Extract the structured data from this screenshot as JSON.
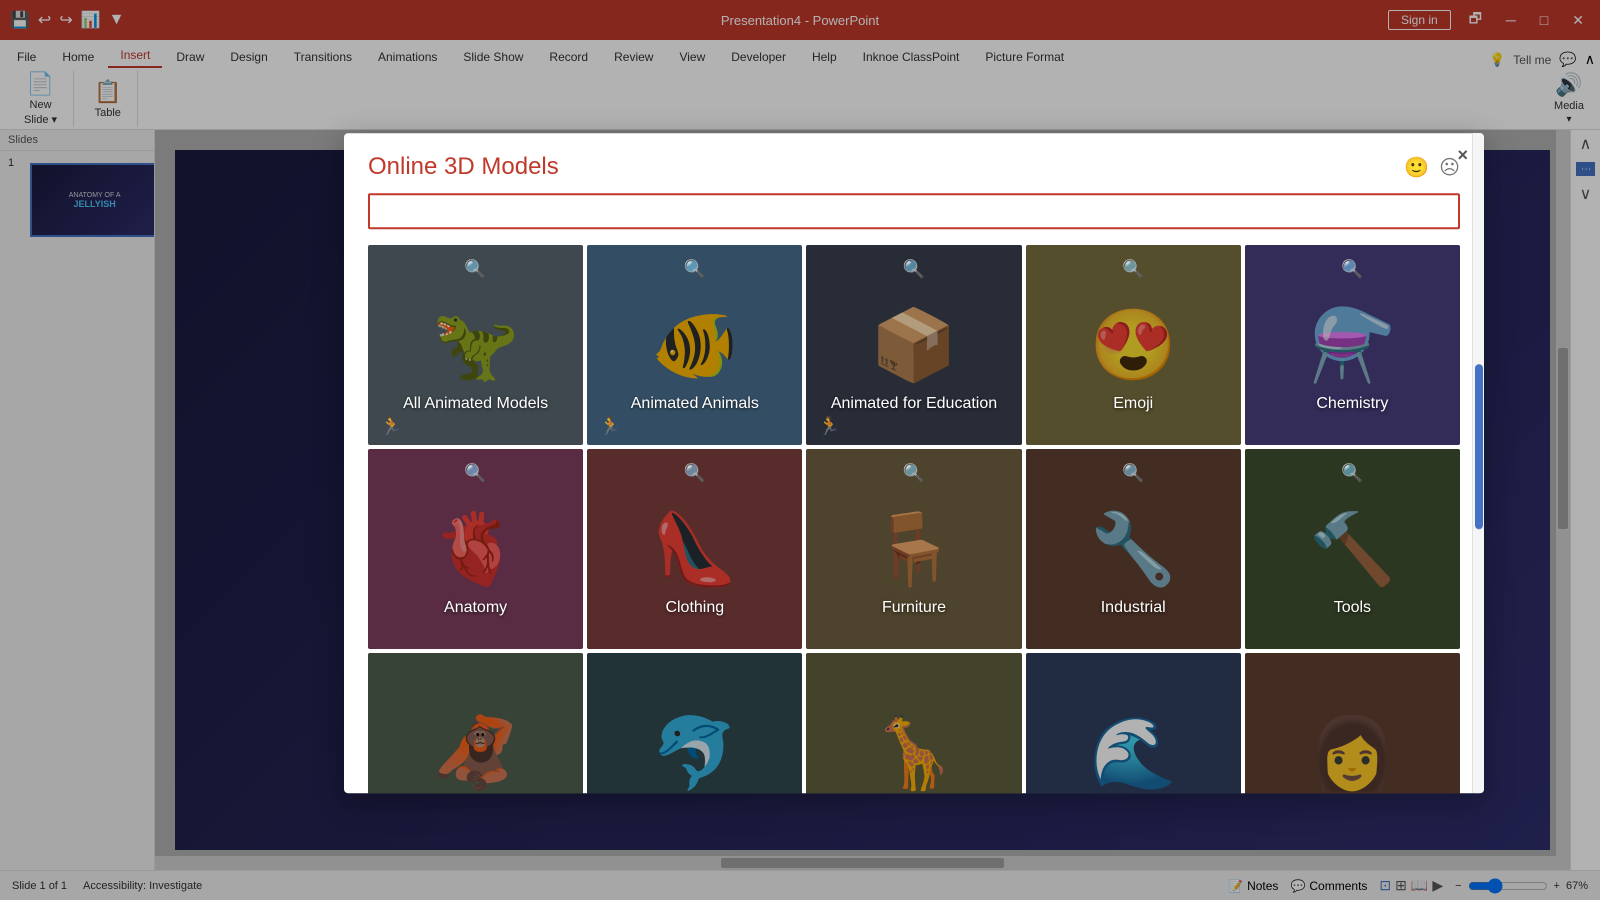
{
  "titleBar": {
    "title": "Presentation4 - PowerPoint",
    "signInLabel": "Sign in",
    "icons": [
      "save",
      "undo",
      "redo",
      "present",
      "more"
    ]
  },
  "ribbon": {
    "tabs": [
      "File",
      "Home",
      "Insert",
      "Draw",
      "Design",
      "Transitions",
      "Animations",
      "Slide Show",
      "Record",
      "Review",
      "View",
      "Developer",
      "Help",
      "Inknoe ClassPoint",
      "Picture Format"
    ],
    "activeTab": "Insert",
    "mediaButton": "Media",
    "telMeLabel": "Tell me"
  },
  "leftPanel": {
    "slidesLabel": "Slides",
    "slideNumber": "1",
    "slideTitle": "ANATOMY OF A",
    "slideSubtitle": "JELLYISH"
  },
  "statusBar": {
    "slideInfo": "Slide 1 of 1",
    "accessibilityLabel": "Accessibility: Investigate",
    "notesLabel": "Notes",
    "commentsLabel": "Comments",
    "zoomLevel": "67%"
  },
  "modal": {
    "title": "Online 3D Models",
    "searchPlaceholder": "",
    "closeButton": "×",
    "categories": [
      {
        "id": "all-animated",
        "label": "All Animated Models",
        "emoji": "🦖",
        "bgColor": "#5a6a7a",
        "hasSearchIcon": true,
        "hasAnimIcon": true
      },
      {
        "id": "animated-animals",
        "label": "Animated Animals",
        "emoji": "🐠",
        "bgColor": "#4a5a6a",
        "hasSearchIcon": true,
        "hasAnimIcon": true
      },
      {
        "id": "animated-education",
        "label": "Animated for Education",
        "emoji": "📦",
        "bgColor": "#3a4a5a",
        "hasSearchIcon": true,
        "hasAnimIcon": true
      },
      {
        "id": "emoji",
        "label": "Emoji",
        "emoji": "😍",
        "bgColor": "#5a5a4a",
        "hasSearchIcon": true,
        "hasAnimIcon": false
      },
      {
        "id": "chemistry",
        "label": "Chemistry",
        "emoji": "⚗️",
        "bgColor": "#4a4a6a",
        "hasSearchIcon": true,
        "hasAnimIcon": false
      },
      {
        "id": "anatomy",
        "label": "Anatomy",
        "emoji": "🫀",
        "bgColor": "#5a4a5a",
        "hasSearchIcon": true,
        "hasAnimIcon": false
      },
      {
        "id": "clothing",
        "label": "Clothing",
        "emoji": "👠",
        "bgColor": "#6a4a4a",
        "hasSearchIcon": true,
        "hasAnimIcon": false
      },
      {
        "id": "furniture",
        "label": "Furniture",
        "emoji": "🪑",
        "bgColor": "#5a5a3a",
        "hasSearchIcon": true,
        "hasAnimIcon": false
      },
      {
        "id": "industrial",
        "label": "Industrial",
        "emoji": "🔧",
        "bgColor": "#4a3a3a",
        "hasSearchIcon": true,
        "hasAnimIcon": false
      },
      {
        "id": "tools",
        "label": "Tools",
        "emoji": "🔨",
        "bgColor": "#3a4a3a",
        "hasSearchIcon": true,
        "hasAnimIcon": false
      },
      {
        "id": "row3-1",
        "label": "",
        "emoji": "🐵",
        "bgColor": "#4a5a4a",
        "hasSearchIcon": false,
        "hasAnimIcon": false
      },
      {
        "id": "row3-2",
        "label": "",
        "emoji": "🐬",
        "bgColor": "#3a5a5a",
        "hasSearchIcon": false,
        "hasAnimIcon": false
      },
      {
        "id": "row3-3",
        "label": "",
        "emoji": "🦒",
        "bgColor": "#5a5a5a",
        "hasSearchIcon": false,
        "hasAnimIcon": false
      },
      {
        "id": "row3-4",
        "label": "",
        "emoji": "🌊",
        "bgColor": "#3a4a5a",
        "hasSearchIcon": false,
        "hasAnimIcon": false
      },
      {
        "id": "row3-5",
        "label": "",
        "emoji": "👩",
        "bgColor": "#5a4a3a",
        "hasSearchIcon": false,
        "hasAnimIcon": false
      }
    ]
  }
}
